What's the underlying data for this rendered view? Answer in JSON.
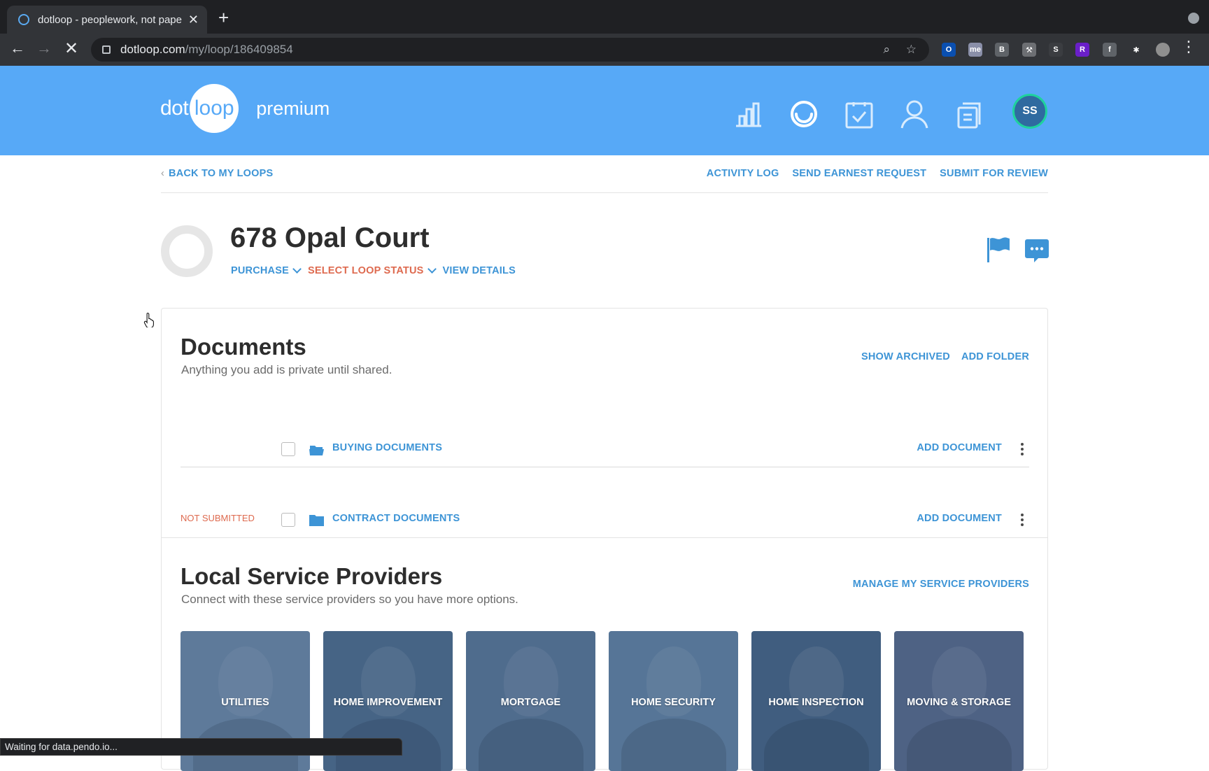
{
  "browser": {
    "tab_title": "dotloop - peoplework, not paperwork",
    "tab_close": "✕",
    "new_tab": "+",
    "url_domain": "dotloop.com",
    "url_path": "/my/loop/186409854",
    "status_text": "Waiting for data.pendo.io...",
    "extensions": [
      {
        "name": "outlook-extension-icon",
        "glyph": "O",
        "color": "#0a4fb0"
      },
      {
        "name": "me-extension-icon",
        "glyph": "me",
        "color": "#8a8fa8"
      },
      {
        "name": "b-extension-icon",
        "glyph": "B",
        "color": "#5f6368"
      },
      {
        "name": "tool-extension-icon",
        "glyph": "⚒",
        "color": "#6d6f73"
      },
      {
        "name": "s-extension-icon",
        "glyph": "S",
        "color": "#3b3d41"
      },
      {
        "name": "r-extension-icon",
        "glyph": "R",
        "color": "#6a1fc9"
      },
      {
        "name": "facebook-extension-icon",
        "glyph": "f",
        "color": "#5f6368"
      },
      {
        "name": "puzzle-extension-icon",
        "glyph": "✱",
        "color": "#323438"
      }
    ]
  },
  "header": {
    "logo_dot": "dot",
    "logo_loop": "loop",
    "logo_premium": "premium",
    "avatar_initials": "SS",
    "brand_color": "#57a9f7"
  },
  "subnav": {
    "back": "BACK TO MY LOOPS",
    "actions": [
      "ACTIVITY LOG",
      "SEND EARNEST REQUEST",
      "SUBMIT FOR REVIEW"
    ]
  },
  "loop": {
    "title": "678 Opal Court",
    "transaction_type": "PURCHASE",
    "status": "SELECT LOOP STATUS",
    "view_details": "VIEW DETAILS"
  },
  "documents": {
    "title": "Documents",
    "subtitle": "Anything you add is private until shared.",
    "show_archived": "SHOW ARCHIVED",
    "add_folder": "ADD FOLDER",
    "folders": [
      {
        "status": "",
        "name": "BUYING DOCUMENTS",
        "add": "ADD DOCUMENT"
      },
      {
        "status": "NOT SUBMITTED",
        "name": "CONTRACT DOCUMENTS",
        "add": "ADD DOCUMENT"
      }
    ]
  },
  "providers": {
    "title": "Local Service Providers",
    "subtitle": "Connect with these service providers so you have more options.",
    "manage": "MANAGE MY SERVICE PROVIDERS",
    "items": [
      {
        "label": "UTILITIES",
        "color": "#8aa4bd"
      },
      {
        "label": "HOME IMPROVEMENT",
        "color": "#5f7c98"
      },
      {
        "label": "MORTGAGE",
        "color": "#6f8aa6"
      },
      {
        "label": "HOME SECURITY",
        "color": "#7d9cb8"
      },
      {
        "label": "HOME INSPECTION",
        "color": "#55708c"
      },
      {
        "label": "MOVING & STORAGE",
        "color": "#6e7896"
      }
    ]
  }
}
